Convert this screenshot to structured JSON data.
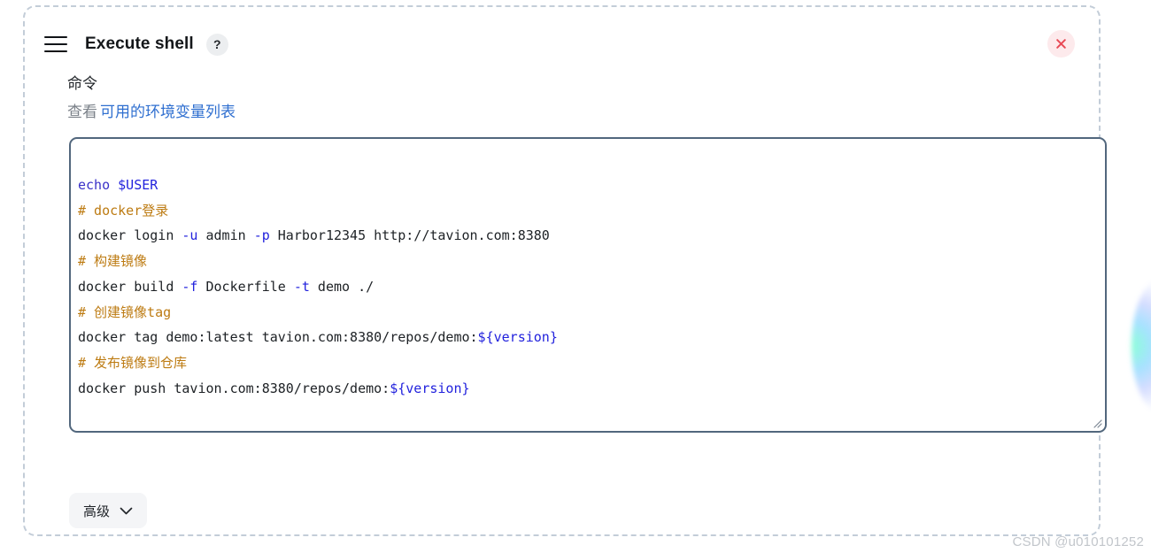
{
  "window": {
    "title": "Execute shell",
    "menu_icon": "hamburger-icon",
    "help_label": "?",
    "close_label": "×"
  },
  "form": {
    "field_label": "命令",
    "hint_prefix": "查看",
    "hint_link": "可用的环境变量列表"
  },
  "code": {
    "raw": "echo $USER\n# docker登录\ndocker login -u admin -p Harbor12345 http://tavion.com:8380\n# 构建镜像\ndocker build -f Dockerfile -t demo ./\n# 创建镜像tag\ndocker tag demo:latest tavion.com:8380/repos/demo:${version}\n# 发布镜像到仓库\ndocker push tavion.com:8380/repos/demo:${version}",
    "lines": [
      {
        "id": "line-1",
        "tokens": [
          {
            "t": "echo",
            "c": "kw"
          },
          {
            "t": " ",
            "c": "txt"
          },
          {
            "t": "$USER",
            "c": "var"
          }
        ]
      },
      {
        "id": "line-2",
        "tokens": [
          {
            "t": "# docker登录",
            "c": "cmt"
          }
        ]
      },
      {
        "id": "line-3",
        "tokens": [
          {
            "t": "docker login ",
            "c": "txt"
          },
          {
            "t": "-u",
            "c": "flag"
          },
          {
            "t": " admin ",
            "c": "txt"
          },
          {
            "t": "-p",
            "c": "flag"
          },
          {
            "t": " Harbor12345 http://tavion.com:8380",
            "c": "txt"
          }
        ]
      },
      {
        "id": "line-4",
        "tokens": [
          {
            "t": "# 构建镜像",
            "c": "cmt"
          }
        ]
      },
      {
        "id": "line-5",
        "tokens": [
          {
            "t": "docker build ",
            "c": "txt"
          },
          {
            "t": "-f",
            "c": "flag"
          },
          {
            "t": " Dockerfile ",
            "c": "txt"
          },
          {
            "t": "-t",
            "c": "flag"
          },
          {
            "t": " demo ./",
            "c": "txt"
          }
        ]
      },
      {
        "id": "line-6",
        "tokens": [
          {
            "t": "# 创建镜像tag",
            "c": "cmt"
          }
        ]
      },
      {
        "id": "line-7",
        "tokens": [
          {
            "t": "docker tag demo:latest tavion.com:8380/repos/demo:",
            "c": "txt"
          },
          {
            "t": "${version}",
            "c": "var"
          }
        ]
      },
      {
        "id": "line-8",
        "tokens": [
          {
            "t": "# 发布镜像到仓库",
            "c": "cmt"
          }
        ]
      },
      {
        "id": "line-9",
        "tokens": [
          {
            "t": "docker push tavion.com:8380/repos/demo:",
            "c": "txt"
          },
          {
            "t": "${version}",
            "c": "var"
          }
        ]
      }
    ]
  },
  "footer": {
    "advanced_label": "高级",
    "chevron_icon": "chevron-down-icon"
  },
  "watermark": "CSDN @u010101252",
  "colors": {
    "link": "#2f6fd0",
    "code_keyword": "#3a31c8",
    "code_variable": "#2222dd",
    "code_comment": "#bd7b12",
    "code_text": "#1d2125",
    "textarea_border": "#52677d",
    "panel_border": "#c3cdd8",
    "close_bg": "#fdeaec",
    "close_fg": "#e84a56",
    "advanced_bg": "#f4f5f7"
  }
}
